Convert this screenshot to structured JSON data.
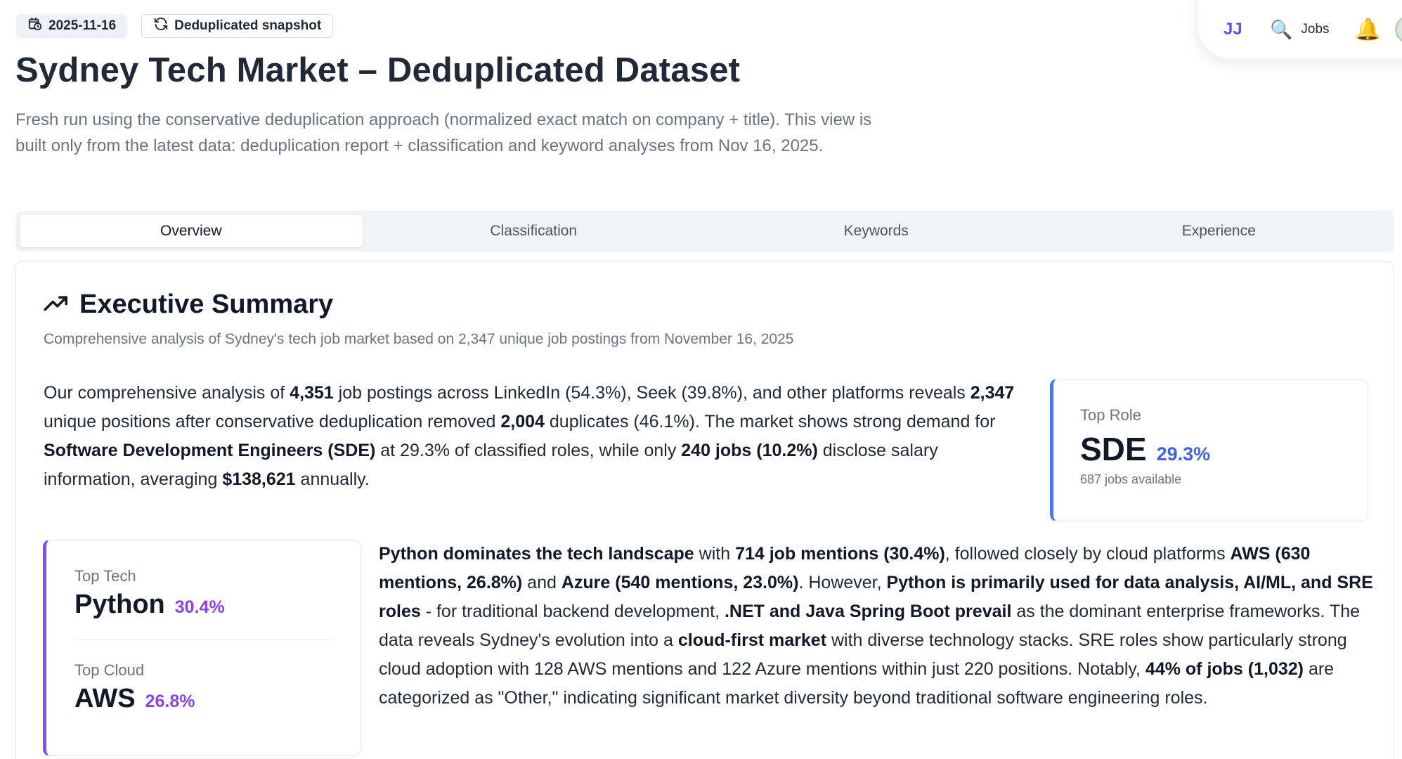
{
  "badges": {
    "date": "2025-11-16",
    "snapshot": "Deduplicated snapshot"
  },
  "topbar": {
    "initials": "JJ",
    "jobs_label": "Jobs"
  },
  "header": {
    "title": "Sydney Tech Market – Deduplicated Dataset",
    "subtitle": "Fresh run using the conservative deduplication approach (normalized exact match on company + title). This view is built only from the latest data: deduplication report + classification and keyword analyses from Nov 16, 2025."
  },
  "tabs": [
    {
      "label": "Overview",
      "active": true
    },
    {
      "label": "Classification",
      "active": false
    },
    {
      "label": "Keywords",
      "active": false
    },
    {
      "label": "Experience",
      "active": false
    }
  ],
  "summary": {
    "title": "Executive Summary",
    "subtitle": "Comprehensive analysis of Sydney's tech job market based on 2,347 unique job postings from November 16, 2025",
    "para1": {
      "t1": "Our comprehensive analysis of ",
      "b1": "4,351",
      "t2": " job postings across LinkedIn (54.3%), Seek (39.8%), and other platforms reveals ",
      "b2": "2,347",
      "t3": " unique positions after conservative deduplication removed ",
      "b3": "2,004",
      "t4": " duplicates (46.1%). The market shows strong demand for ",
      "b4": "Software Development Engineers (SDE)",
      "t5": " at 29.3% of classified roles, while only ",
      "b5": "240 jobs (10.2%)",
      "t6": " disclose salary information, averaging ",
      "b6": "$138,621",
      "t7": " annually."
    },
    "para2": {
      "b1": "Python dominates the tech landscape",
      "t1": " with ",
      "b2": "714 job mentions (30.4%)",
      "t2": ", followed closely by cloud platforms ",
      "b3": "AWS (630 mentions, 26.8%)",
      "t3": " and ",
      "b4": "Azure (540 mentions, 23.0%)",
      "t4": ". However, ",
      "b5": "Python is primarily used for data analysis, AI/ML, and SRE roles",
      "t5": " - for traditional backend development, ",
      "b6": ".NET and Java Spring Boot prevail",
      "t6": " as the dominant enterprise frameworks. The data reveals Sydney's evolution into a ",
      "b7": "cloud-first market",
      "t7": " with diverse technology stacks. SRE roles show particularly strong cloud adoption with 128 AWS mentions and 122 Azure mentions within just 220 positions. Notably, ",
      "b8": "44% of jobs (1,032)",
      "t8": " are categorized as \"Other,\" indicating significant market diversity beyond traditional software engineering roles."
    }
  },
  "top_role": {
    "label": "Top Role",
    "value": "SDE",
    "pct": "29.3%",
    "foot": "687 jobs available"
  },
  "top_tech": {
    "label": "Top Tech",
    "value": "Python",
    "pct": "30.4%"
  },
  "top_cloud": {
    "label": "Top Cloud",
    "value": "AWS",
    "pct": "26.8%"
  },
  "colors": {
    "role_accent": "#4a78e8",
    "tech_accent": "#8a4fe0",
    "initials": "#6d4ee6"
  },
  "icons": [
    "calendar-clock-icon",
    "refresh-icon",
    "search-icon",
    "bell-icon",
    "trending-up-icon"
  ]
}
